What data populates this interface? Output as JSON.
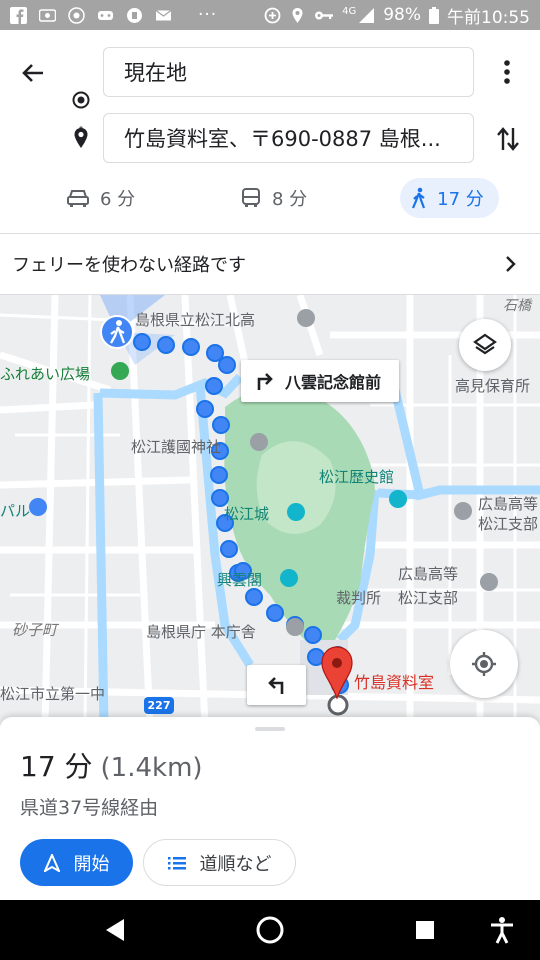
{
  "status_bar": {
    "battery": "98%",
    "time": "午前10:55",
    "signal": "4G",
    "dots": "···"
  },
  "directions": {
    "origin": "現在地",
    "destination": "竹島資料室、〒690-0887 島根..."
  },
  "modes": [
    {
      "name": "car",
      "time": "6 分"
    },
    {
      "name": "bus",
      "time": "8 分"
    },
    {
      "name": "walk",
      "time": "17 分",
      "selected": true
    }
  ],
  "ferry_notice": "フェリーを使わない経路です",
  "map": {
    "labels": {
      "north_high": "島根県立松江北高",
      "fureai": "ふれあい広場",
      "gokoku": "松江護國神社",
      "castle": "松江城",
      "history": "松江歴史館",
      "kouun": "興雲閣",
      "prefecture": "島根県庁 本庁舎",
      "destination": "竹島資料室",
      "takami": "高見保育所",
      "hiroshima_high": "広島高等",
      "matsue_branch": "松江支部",
      "court": "裁判所",
      "court_branch": "松江支部",
      "hiroshima_high2": "広島高等",
      "matsue_branch2": "松江支部",
      "ishibashi": "石橋",
      "sunago": "砂子町",
      "matsue_city": "松江市立第一中",
      "paru": "パル"
    },
    "turn_right": "八雲記念館前",
    "route_shield": "227"
  },
  "summary": {
    "duration": "17 分",
    "distance": "(1.4km)",
    "via": "県道37号線経由",
    "start_label": "開始",
    "steps_label": "道順など"
  },
  "colors": {
    "accent": "#1a73e8",
    "route": "#1a73e8",
    "park": "#a8dab5",
    "water": "#aadaff",
    "pin": "#ea4335"
  }
}
